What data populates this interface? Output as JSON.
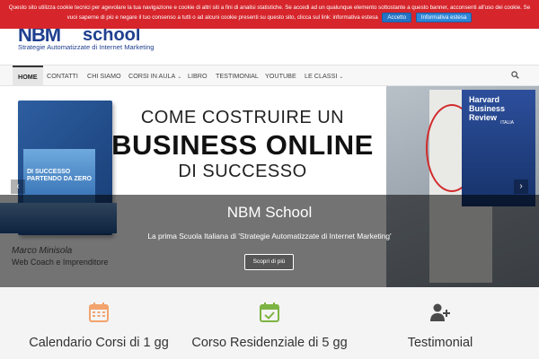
{
  "cookie_banner": {
    "text": "Questo sito utilizza cookie tecnici per agevolare la tua navigazione e cookie di altri siti a fini di analisi statistiche. Se accedi ad un qualunque elemento sottostante a questo banner, acconsenti all'uso dei cookie. Se vuoi saperne di più e negare il tuo consenso a tutti o ad alcuni cookie presenti su questo sito, clicca sul link: informativa estesa",
    "accept_label": "Accetto",
    "info_label": "Informativa estesa"
  },
  "logo": {
    "brand": "NBM",
    "brand_suffix": "school",
    "tagline": "Strategie Automatizzate di Internet Marketing"
  },
  "nav": {
    "items": [
      {
        "label": "HOME"
      },
      {
        "label": "CONTATTI"
      },
      {
        "label": "CHI SIAMO"
      },
      {
        "label": "CORSI IN AULA"
      },
      {
        "label": "LIBRO"
      },
      {
        "label": "TESTIMONIAL"
      },
      {
        "label": "YOUTUBE"
      },
      {
        "label": "LE CLASSI"
      }
    ]
  },
  "hero": {
    "title_line1": "COME COSTRUIRE UN",
    "title_line2": "BUSINESS ONLINE",
    "title_line3": "DI SUCCESSO",
    "book_title": "DI SUCCESSO",
    "book_subtitle": "PARTENDO DA ZERO",
    "magazine_title": "Harvard Business Review",
    "magazine_edition": "ITALIA",
    "caption_title": "NBM School",
    "caption_subtitle": "La prima Scuola Italiana di 'Strategie Automatizzate di Internet Marketing'",
    "cta_label": "Scopri di più",
    "author_name": "Marco Minisola",
    "author_role": "Web Coach e Imprenditore"
  },
  "features": [
    {
      "label": "Calendario Corsi di 1 gg",
      "icon": "calendar-icon",
      "color": "#f2a36e"
    },
    {
      "label": "Corso Residenziale di 5 gg",
      "icon": "calendar-check-icon",
      "color": "#7cb342"
    },
    {
      "label": "Testimonial",
      "icon": "user-plus-icon",
      "color": "#4a4a4a"
    }
  ],
  "colors": {
    "cookie_bg": "#d6252b",
    "brand_blue": "#1f3f8f",
    "button_blue": "#2473c4"
  }
}
